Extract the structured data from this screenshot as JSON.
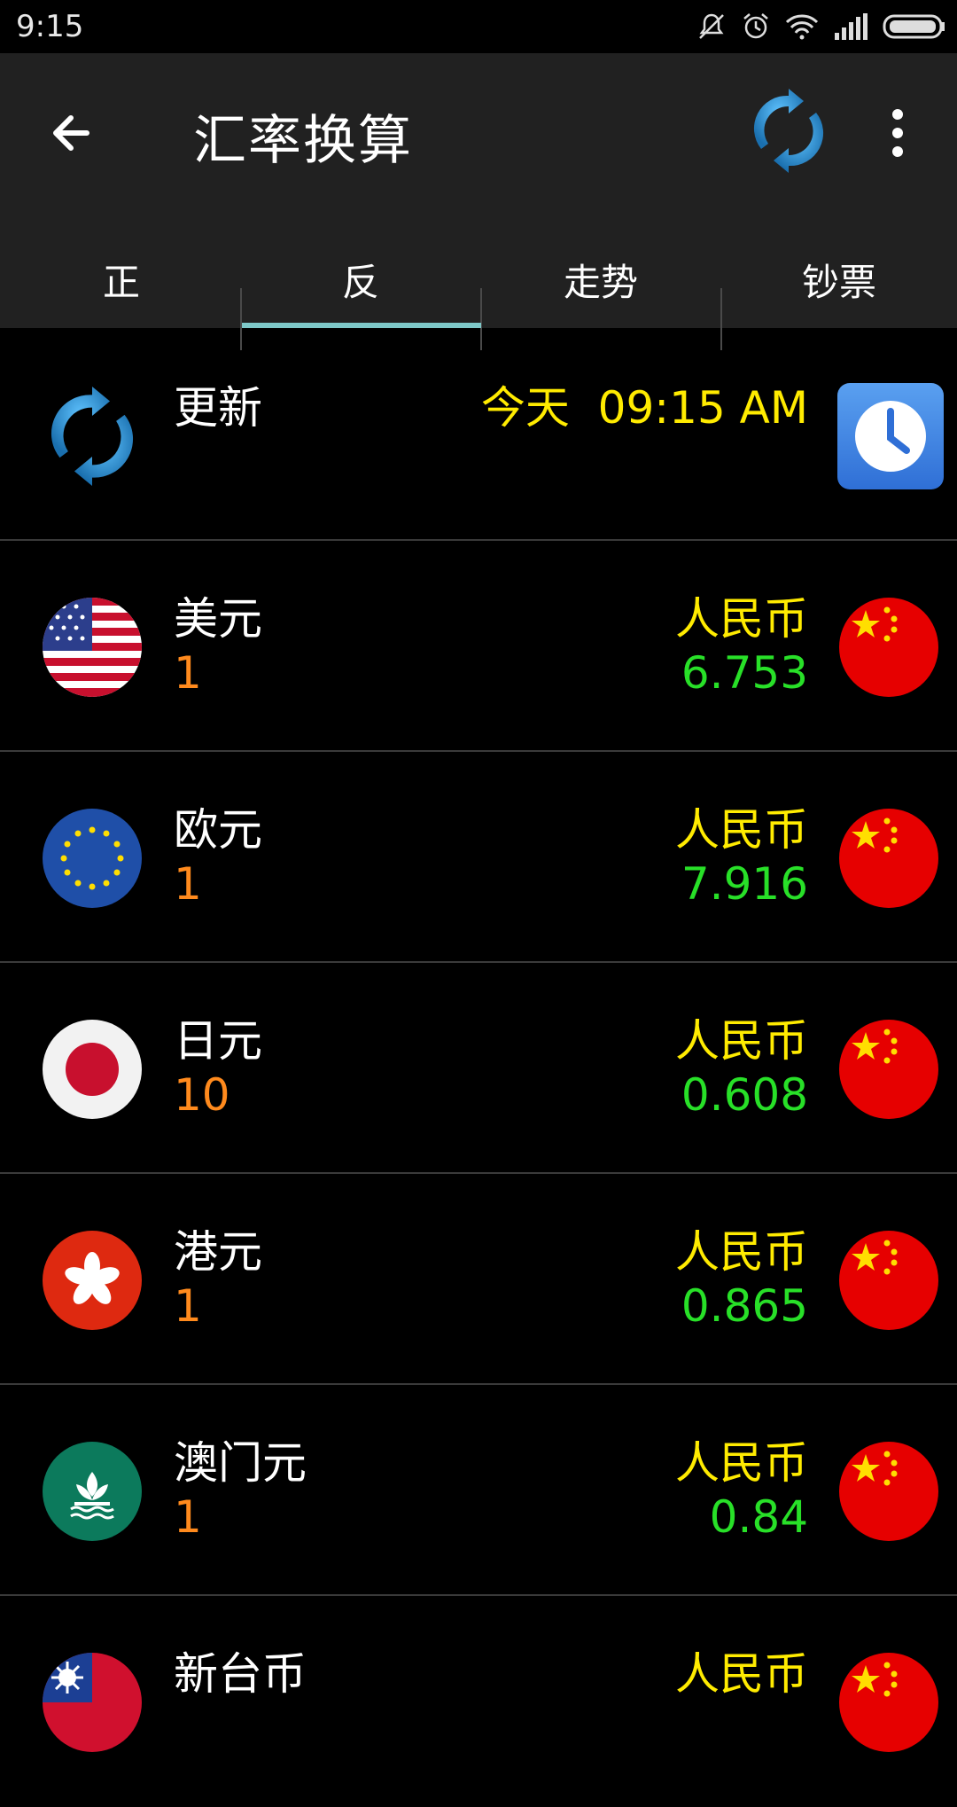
{
  "status_bar": {
    "time": "9:15"
  },
  "app_bar": {
    "title": "汇率换算"
  },
  "tabs": [
    {
      "label": "正"
    },
    {
      "label": "反"
    },
    {
      "label": "走势"
    },
    {
      "label": "钞票"
    }
  ],
  "selected_tab": "反",
  "update_row": {
    "label": "更新",
    "time_text": "今天  09:15 AM"
  },
  "rates": [
    {
      "name": "美元",
      "amount": "1",
      "target": "人民币",
      "value": "6.753",
      "flag_icon": "us-flag-icon"
    },
    {
      "name": "欧元",
      "amount": "1",
      "target": "人民币",
      "value": "7.916",
      "flag_icon": "eu-flag-icon"
    },
    {
      "name": "日元",
      "amount": "10",
      "target": "人民币",
      "value": "0.608",
      "flag_icon": "japan-flag-icon"
    },
    {
      "name": "港元",
      "amount": "1",
      "target": "人民币",
      "value": "0.865",
      "flag_icon": "hongkong-flag-icon"
    },
    {
      "name": "澳门元",
      "amount": "1",
      "target": "人民币",
      "value": "0.84",
      "flag_icon": "macau-flag-icon"
    },
    {
      "name": "新台币",
      "amount": "",
      "target": "人民币",
      "value": "",
      "flag_icon": "taiwan-flag-icon"
    }
  ],
  "colors": {
    "appbar_bg": "#212121",
    "tab_indicator": "#7ec8c8",
    "update_text": "#ffeb00",
    "target_text": "#ffeb00",
    "value_text": "#28e028",
    "amount_text": "#ff8a1d"
  }
}
